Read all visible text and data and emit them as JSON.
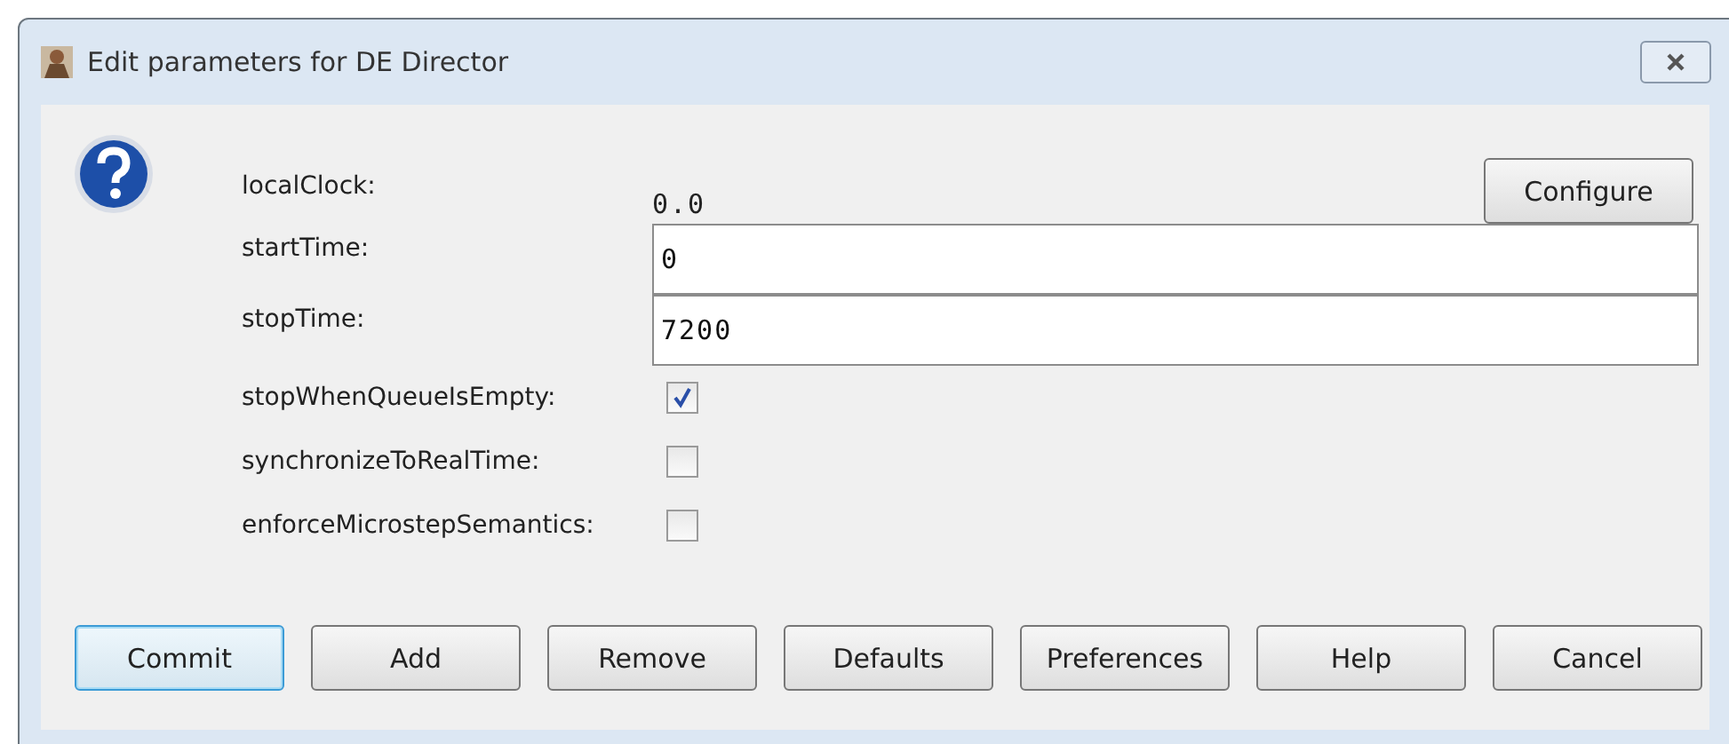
{
  "window": {
    "title": "Edit parameters for DE Director"
  },
  "parameters": [
    {
      "kind": "text",
      "label": "localClock:",
      "value": "0.0",
      "button": "Configure"
    },
    {
      "kind": "field",
      "label": "startTime:",
      "value": "0"
    },
    {
      "kind": "field",
      "label": "stopTime:",
      "value": "7200"
    },
    {
      "kind": "checkbox",
      "label": "stopWhenQueueIsEmpty:",
      "checked": true
    },
    {
      "kind": "checkbox",
      "label": "synchronizeToRealTime:",
      "checked": false
    },
    {
      "kind": "checkbox",
      "label": "enforceMicrostepSemantics:",
      "checked": false
    }
  ],
  "buttons": [
    {
      "label": "Commit",
      "focused": true
    },
    {
      "label": "Add",
      "focused": false
    },
    {
      "label": "Remove",
      "focused": false
    },
    {
      "label": "Defaults",
      "focused": false
    },
    {
      "label": "Preferences",
      "focused": false
    },
    {
      "label": "Help",
      "focused": false
    },
    {
      "label": "Cancel",
      "focused": false
    }
  ]
}
